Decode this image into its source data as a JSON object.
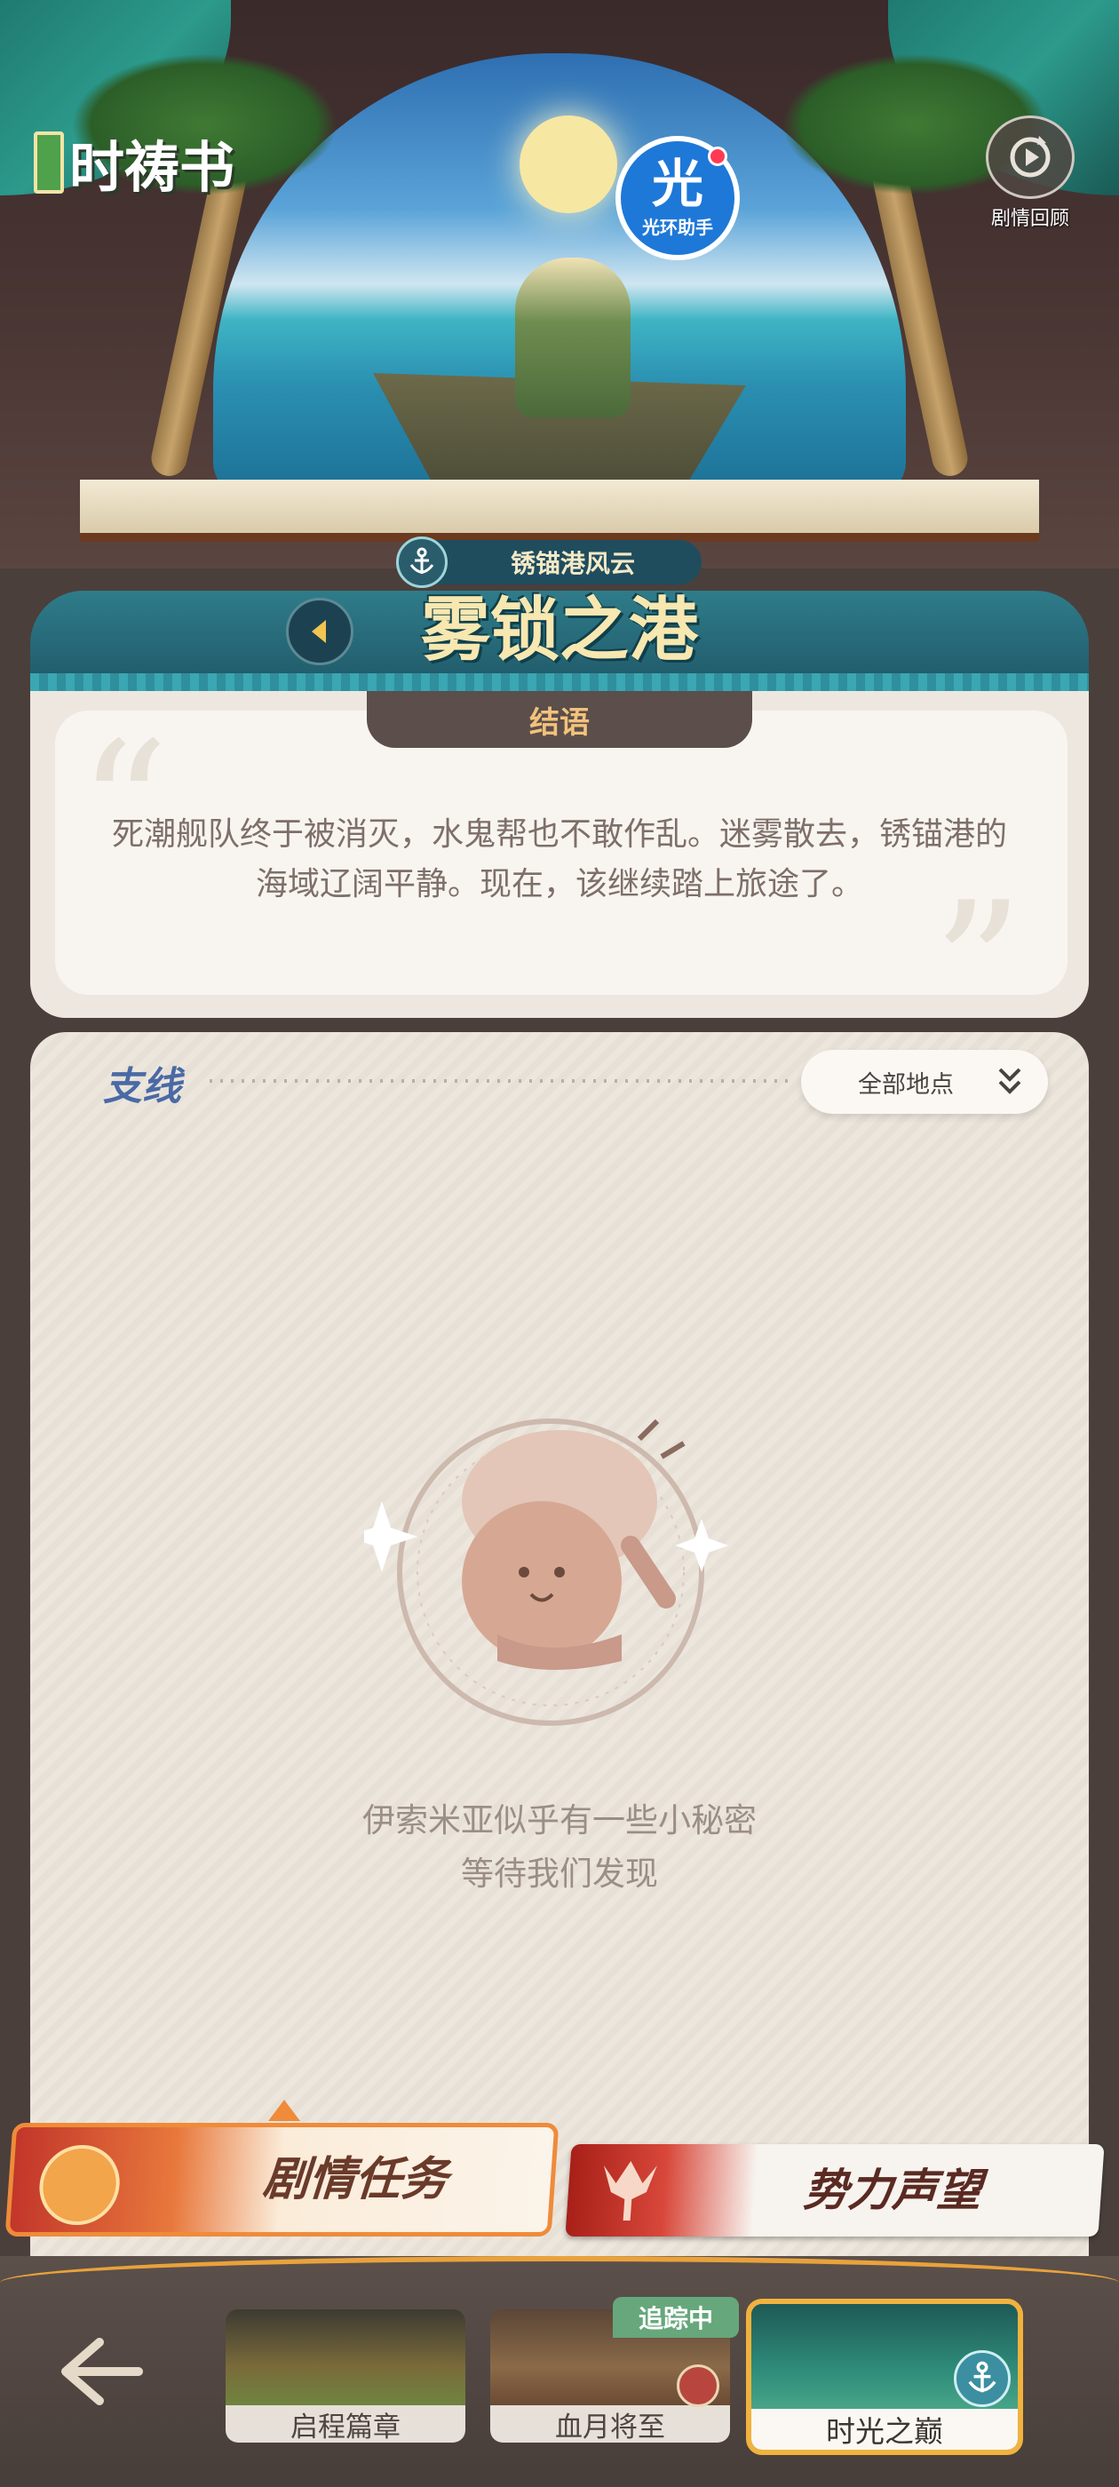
{
  "app": {
    "logo_text": "时祷书",
    "assistant_badge": {
      "glyph": "光",
      "label": "光环助手"
    },
    "replay": {
      "label": "剧情回顾",
      "icon": "replay-icon"
    }
  },
  "chapter": {
    "tag": "锈锚港风云",
    "title": "雾锁之港"
  },
  "epilogue": {
    "tab_label": "结语",
    "text": "死潮舰队终于被消灭，水鬼帮也不敢作乱。迷雾散去，锈锚港的海域辽阔平静。现在，该继续踏上旅途了。"
  },
  "side_quests": {
    "title": "支线",
    "filter_label": "全部地点",
    "empty_line1": "伊索米亚似乎有一些小秘密",
    "empty_line2": "等待我们发现"
  },
  "main_tabs": {
    "story": "剧情任务",
    "reputation": "势力声望"
  },
  "chapters": [
    {
      "label": "启程篇章"
    },
    {
      "label": "血月将至",
      "badge": "追踪中"
    },
    {
      "label": "时光之巅"
    }
  ],
  "colors": {
    "accent_gold": "#f1b23e",
    "teal": "#2f7c8a",
    "tracking_green": "#67a77c",
    "story_orange": "#ef8b3a"
  }
}
